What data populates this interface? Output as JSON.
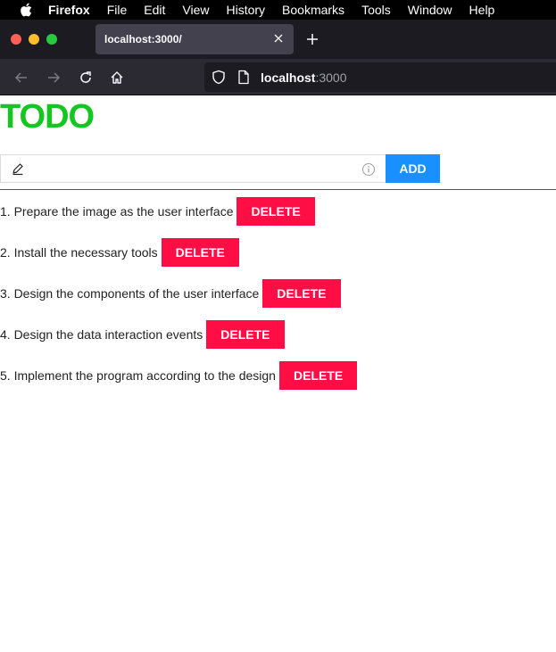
{
  "menubar": {
    "app_name": "Firefox",
    "items": [
      "File",
      "Edit",
      "View",
      "History",
      "Bookmarks",
      "Tools",
      "Window",
      "Help"
    ]
  },
  "tab": {
    "title": "localhost:3000/"
  },
  "urlbar": {
    "host": "localhost",
    "port": ":3000"
  },
  "page": {
    "title": "TODO",
    "input_value": "",
    "add_label": "ADD",
    "todos": [
      {
        "text": "1. Prepare the image as the user interface",
        "delete_label": "DELETE"
      },
      {
        "text": "2. Install the necessary tools",
        "delete_label": "DELETE"
      },
      {
        "text": "3. Design the components of the user interface",
        "delete_label": "DELETE"
      },
      {
        "text": "4. Design the data interaction events",
        "delete_label": "DELETE"
      },
      {
        "text": "5. Implement the program according to the design",
        "delete_label": "DELETE"
      }
    ]
  },
  "colors": {
    "title_green": "#14c61f",
    "add_blue": "#1890ff",
    "delete_red": "#ff0d45"
  },
  "icons": [
    "apple-icon",
    "close-icon",
    "plus-icon",
    "back-arrow-icon",
    "forward-arrow-icon",
    "reload-icon",
    "home-icon",
    "shield-icon",
    "page-icon",
    "pencil-icon",
    "info-icon"
  ]
}
